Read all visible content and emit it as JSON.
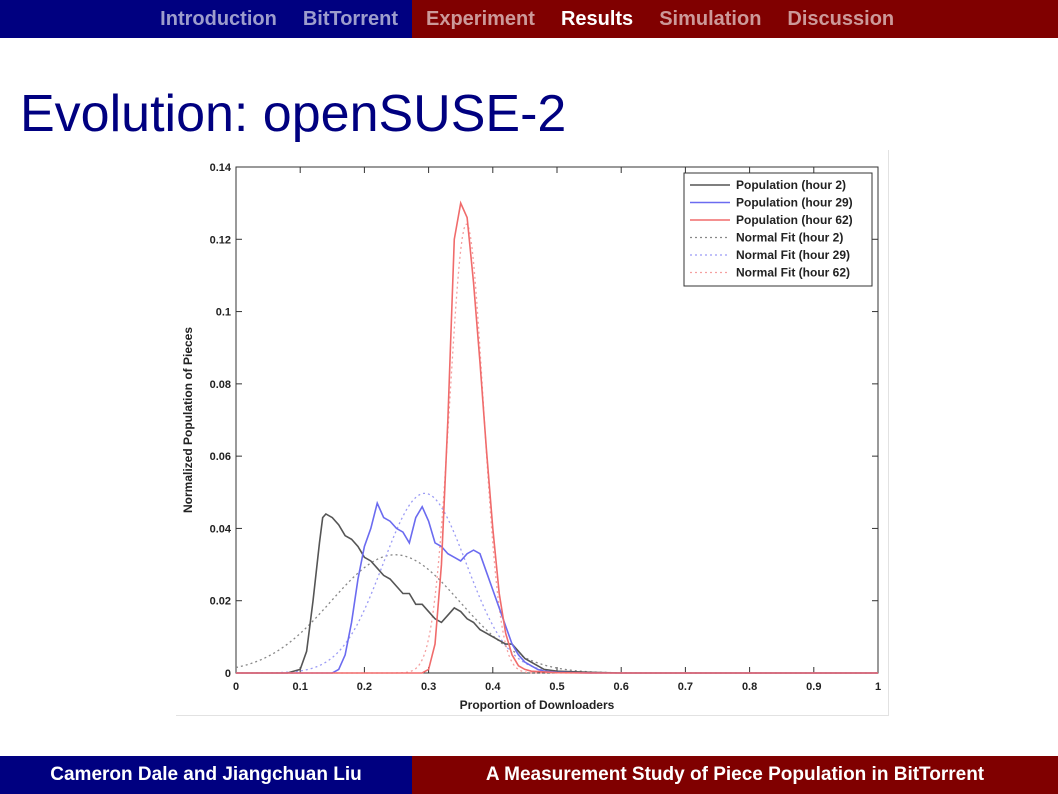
{
  "nav": {
    "left_items": [
      "Introduction",
      "BitTorrent"
    ],
    "right_items": [
      "Experiment",
      "Results",
      "Simulation",
      "Discussion"
    ],
    "active": "Results",
    "colors": {
      "left_bg": "#000080",
      "right_bg": "#800000"
    }
  },
  "slide": {
    "title": "Evolution: openSUSE-2"
  },
  "footer": {
    "authors": "Cameron Dale and Jiangchuan Liu",
    "paper_title": "A Measurement Study of Piece Population in BitTorrent"
  },
  "chart_data": {
    "type": "line",
    "title": "",
    "xlabel": "Proportion of Downloaders",
    "ylabel": "Normalized Population of Pieces",
    "xlim": [
      0,
      1
    ],
    "ylim": [
      0,
      0.14
    ],
    "xticks": [
      "0",
      "0.1",
      "0.2",
      "0.3",
      "0.4",
      "0.5",
      "0.6",
      "0.7",
      "0.8",
      "0.9",
      "1"
    ],
    "yticks": [
      "0",
      "0.02",
      "0.04",
      "0.06",
      "0.08",
      "0.1",
      "0.12",
      "0.14"
    ],
    "grid": false,
    "legend_position": "top-right",
    "series": [
      {
        "name": "Population (hour 2)",
        "color": "#555555",
        "style": "solid",
        "points": [
          [
            0,
            0
          ],
          [
            0.08,
            0
          ],
          [
            0.1,
            0.001
          ],
          [
            0.11,
            0.006
          ],
          [
            0.12,
            0.02
          ],
          [
            0.13,
            0.036
          ],
          [
            0.135,
            0.043
          ],
          [
            0.14,
            0.044
          ],
          [
            0.15,
            0.043
          ],
          [
            0.16,
            0.041
          ],
          [
            0.17,
            0.038
          ],
          [
            0.18,
            0.037
          ],
          [
            0.19,
            0.035
          ],
          [
            0.2,
            0.032
          ],
          [
            0.21,
            0.031
          ],
          [
            0.22,
            0.029
          ],
          [
            0.23,
            0.027
          ],
          [
            0.24,
            0.026
          ],
          [
            0.25,
            0.024
          ],
          [
            0.26,
            0.022
          ],
          [
            0.27,
            0.022
          ],
          [
            0.28,
            0.019
          ],
          [
            0.29,
            0.019
          ],
          [
            0.3,
            0.017
          ],
          [
            0.31,
            0.015
          ],
          [
            0.32,
            0.014
          ],
          [
            0.33,
            0.016
          ],
          [
            0.34,
            0.018
          ],
          [
            0.35,
            0.017
          ],
          [
            0.36,
            0.015
          ],
          [
            0.37,
            0.014
          ],
          [
            0.38,
            0.012
          ],
          [
            0.39,
            0.011
          ],
          [
            0.4,
            0.01
          ],
          [
            0.41,
            0.009
          ],
          [
            0.42,
            0.008
          ],
          [
            0.43,
            0.008
          ],
          [
            0.44,
            0.006
          ],
          [
            0.45,
            0.004
          ],
          [
            0.46,
            0.003
          ],
          [
            0.47,
            0.002
          ],
          [
            0.48,
            0.001
          ],
          [
            0.5,
            0.0005
          ],
          [
            0.55,
            0.0002
          ],
          [
            0.6,
            0
          ],
          [
            1,
            0
          ]
        ]
      },
      {
        "name": "Population (hour 29)",
        "color": "#6b6bf0",
        "style": "solid",
        "points": [
          [
            0,
            0
          ],
          [
            0.15,
            0
          ],
          [
            0.16,
            0.001
          ],
          [
            0.17,
            0.005
          ],
          [
            0.18,
            0.014
          ],
          [
            0.19,
            0.026
          ],
          [
            0.2,
            0.035
          ],
          [
            0.21,
            0.04
          ],
          [
            0.22,
            0.047
          ],
          [
            0.23,
            0.043
          ],
          [
            0.24,
            0.042
          ],
          [
            0.25,
            0.04
          ],
          [
            0.26,
            0.039
          ],
          [
            0.27,
            0.036
          ],
          [
            0.28,
            0.043
          ],
          [
            0.29,
            0.046
          ],
          [
            0.3,
            0.042
          ],
          [
            0.31,
            0.036
          ],
          [
            0.32,
            0.035
          ],
          [
            0.33,
            0.033
          ],
          [
            0.34,
            0.032
          ],
          [
            0.35,
            0.031
          ],
          [
            0.36,
            0.033
          ],
          [
            0.37,
            0.034
          ],
          [
            0.38,
            0.033
          ],
          [
            0.39,
            0.028
          ],
          [
            0.4,
            0.023
          ],
          [
            0.41,
            0.018
          ],
          [
            0.42,
            0.013
          ],
          [
            0.43,
            0.008
          ],
          [
            0.44,
            0.005
          ],
          [
            0.45,
            0.003
          ],
          [
            0.46,
            0.002
          ],
          [
            0.47,
            0.001
          ],
          [
            0.48,
            0.0005
          ],
          [
            0.5,
            0.0002
          ],
          [
            0.55,
            0
          ],
          [
            1,
            0
          ]
        ]
      },
      {
        "name": "Population (hour 62)",
        "color": "#f06b6b",
        "style": "solid",
        "points": [
          [
            0,
            0
          ],
          [
            0.29,
            0
          ],
          [
            0.3,
            0.001
          ],
          [
            0.31,
            0.008
          ],
          [
            0.32,
            0.03
          ],
          [
            0.33,
            0.07
          ],
          [
            0.34,
            0.12
          ],
          [
            0.35,
            0.13
          ],
          [
            0.36,
            0.126
          ],
          [
            0.37,
            0.108
          ],
          [
            0.38,
            0.086
          ],
          [
            0.39,
            0.062
          ],
          [
            0.4,
            0.04
          ],
          [
            0.41,
            0.022
          ],
          [
            0.42,
            0.011
          ],
          [
            0.43,
            0.005
          ],
          [
            0.44,
            0.002
          ],
          [
            0.45,
            0.001
          ],
          [
            0.46,
            0.0005
          ],
          [
            0.5,
            0.0001
          ],
          [
            0.55,
            0
          ],
          [
            1,
            0
          ]
        ]
      },
      {
        "name": "Normal Fit (hour 2)",
        "color": "#888888",
        "style": "dotted",
        "mean": 0.248,
        "sd": 0.1,
        "area": 0.0082
      },
      {
        "name": "Normal Fit (hour 29)",
        "color": "#9b9bf5",
        "style": "dotted",
        "mean": 0.294,
        "sd": 0.065,
        "area": 0.0081
      },
      {
        "name": "Normal Fit (hour 62)",
        "color": "#f5a0a0",
        "style": "dotted",
        "mean": 0.359,
        "sd": 0.026,
        "area": 0.0081
      }
    ]
  }
}
